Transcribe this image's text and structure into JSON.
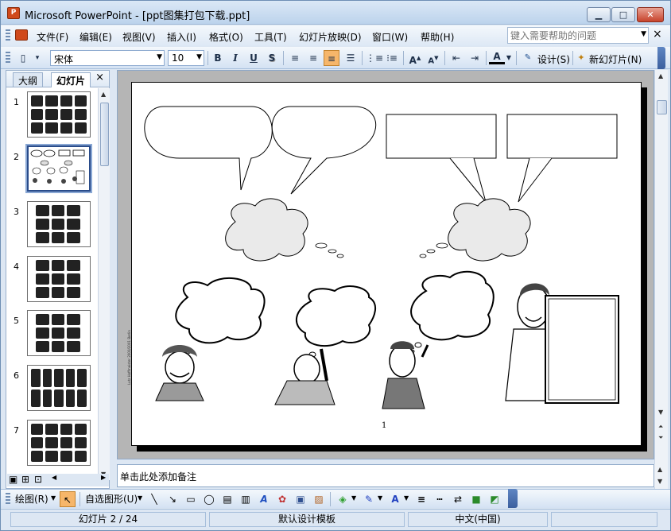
{
  "window": {
    "title": "Microsoft PowerPoint - [ppt图集打包下载.ppt]",
    "minimize": "▁",
    "maximize": "□",
    "close": "✕"
  },
  "menu": {
    "items": [
      "文件(F)",
      "编辑(E)",
      "视图(V)",
      "插入(I)",
      "格式(O)",
      "工具(T)",
      "幻灯片放映(D)",
      "窗口(W)",
      "帮助(H)"
    ],
    "help_placeholder": "键入需要帮助的问题",
    "doc_close": "×"
  },
  "toolbar": {
    "font_name": "宋体",
    "font_size": "10",
    "bold": "B",
    "italic": "I",
    "underline": "U",
    "shadow": "S",
    "design_label": "设计(S)",
    "new_slide_label": "新幻灯片(N)"
  },
  "outline_pane": {
    "tab_outline": "大纲",
    "tab_slides": "幻灯片",
    "close": "×",
    "slides": [
      {
        "num": "1",
        "selected": false
      },
      {
        "num": "2",
        "selected": true
      },
      {
        "num": "3",
        "selected": false
      },
      {
        "num": "4",
        "selected": false
      },
      {
        "num": "5",
        "selected": false
      },
      {
        "num": "6",
        "selected": false
      },
      {
        "num": "7",
        "selected": false
      }
    ]
  },
  "slide": {
    "page_number": "1",
    "credit": "Lutz Hoffmeister 2000/2001 Berlin"
  },
  "notes": {
    "placeholder": "单击此处添加备注"
  },
  "drawing_toolbar": {
    "draw_label": "绘图(R)",
    "autoshapes_label": "自选图形(U)"
  },
  "status": {
    "slide_info": "幻灯片 2 / 24",
    "template": "默认设计模板",
    "language": "中文(中国)"
  }
}
